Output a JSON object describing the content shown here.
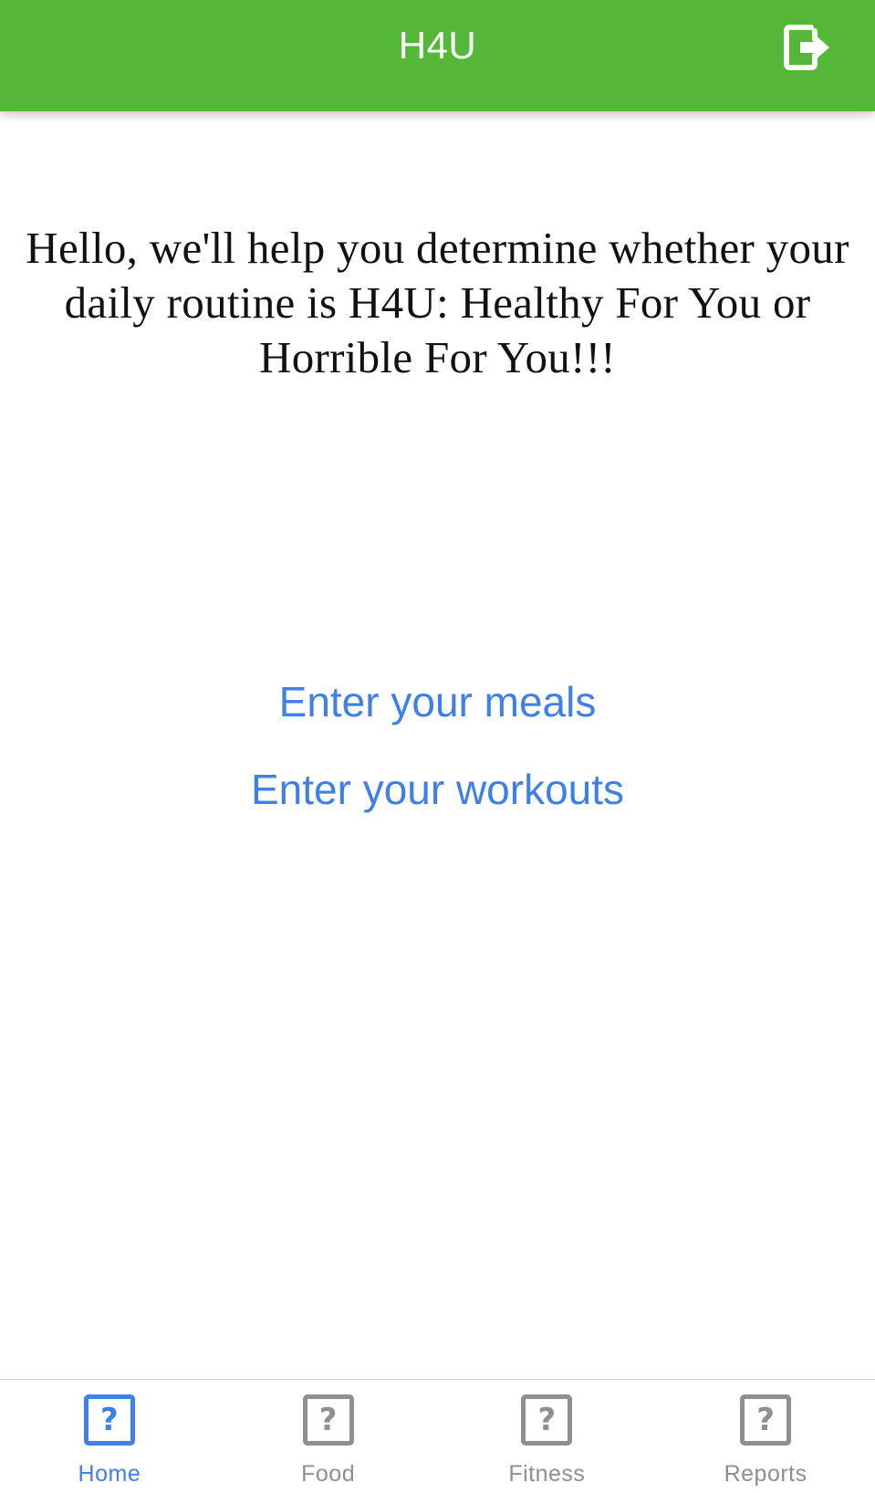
{
  "header": {
    "title": "H4U",
    "logout_icon": "logout-icon"
  },
  "main": {
    "welcome_text": "Hello, we'll help you determine whether your daily routine is H4U: Healthy For You or Horrible For You!!!",
    "links": {
      "meals": "Enter your meals",
      "workouts": "Enter your workouts"
    }
  },
  "tabbar": {
    "active_tab": "Home",
    "tabs": [
      {
        "label": "Home",
        "icon": "question-mark-icon",
        "icon_glyph": "?"
      },
      {
        "label": "Food",
        "icon": "question-mark-icon",
        "icon_glyph": "?"
      },
      {
        "label": "Fitness",
        "icon": "question-mark-icon",
        "icon_glyph": "?"
      },
      {
        "label": "Reports",
        "icon": "question-mark-icon",
        "icon_glyph": "?"
      }
    ]
  },
  "colors": {
    "header_green": "#55b738",
    "link_blue": "#3f80e6",
    "tab_inactive": "#8e8e93"
  }
}
